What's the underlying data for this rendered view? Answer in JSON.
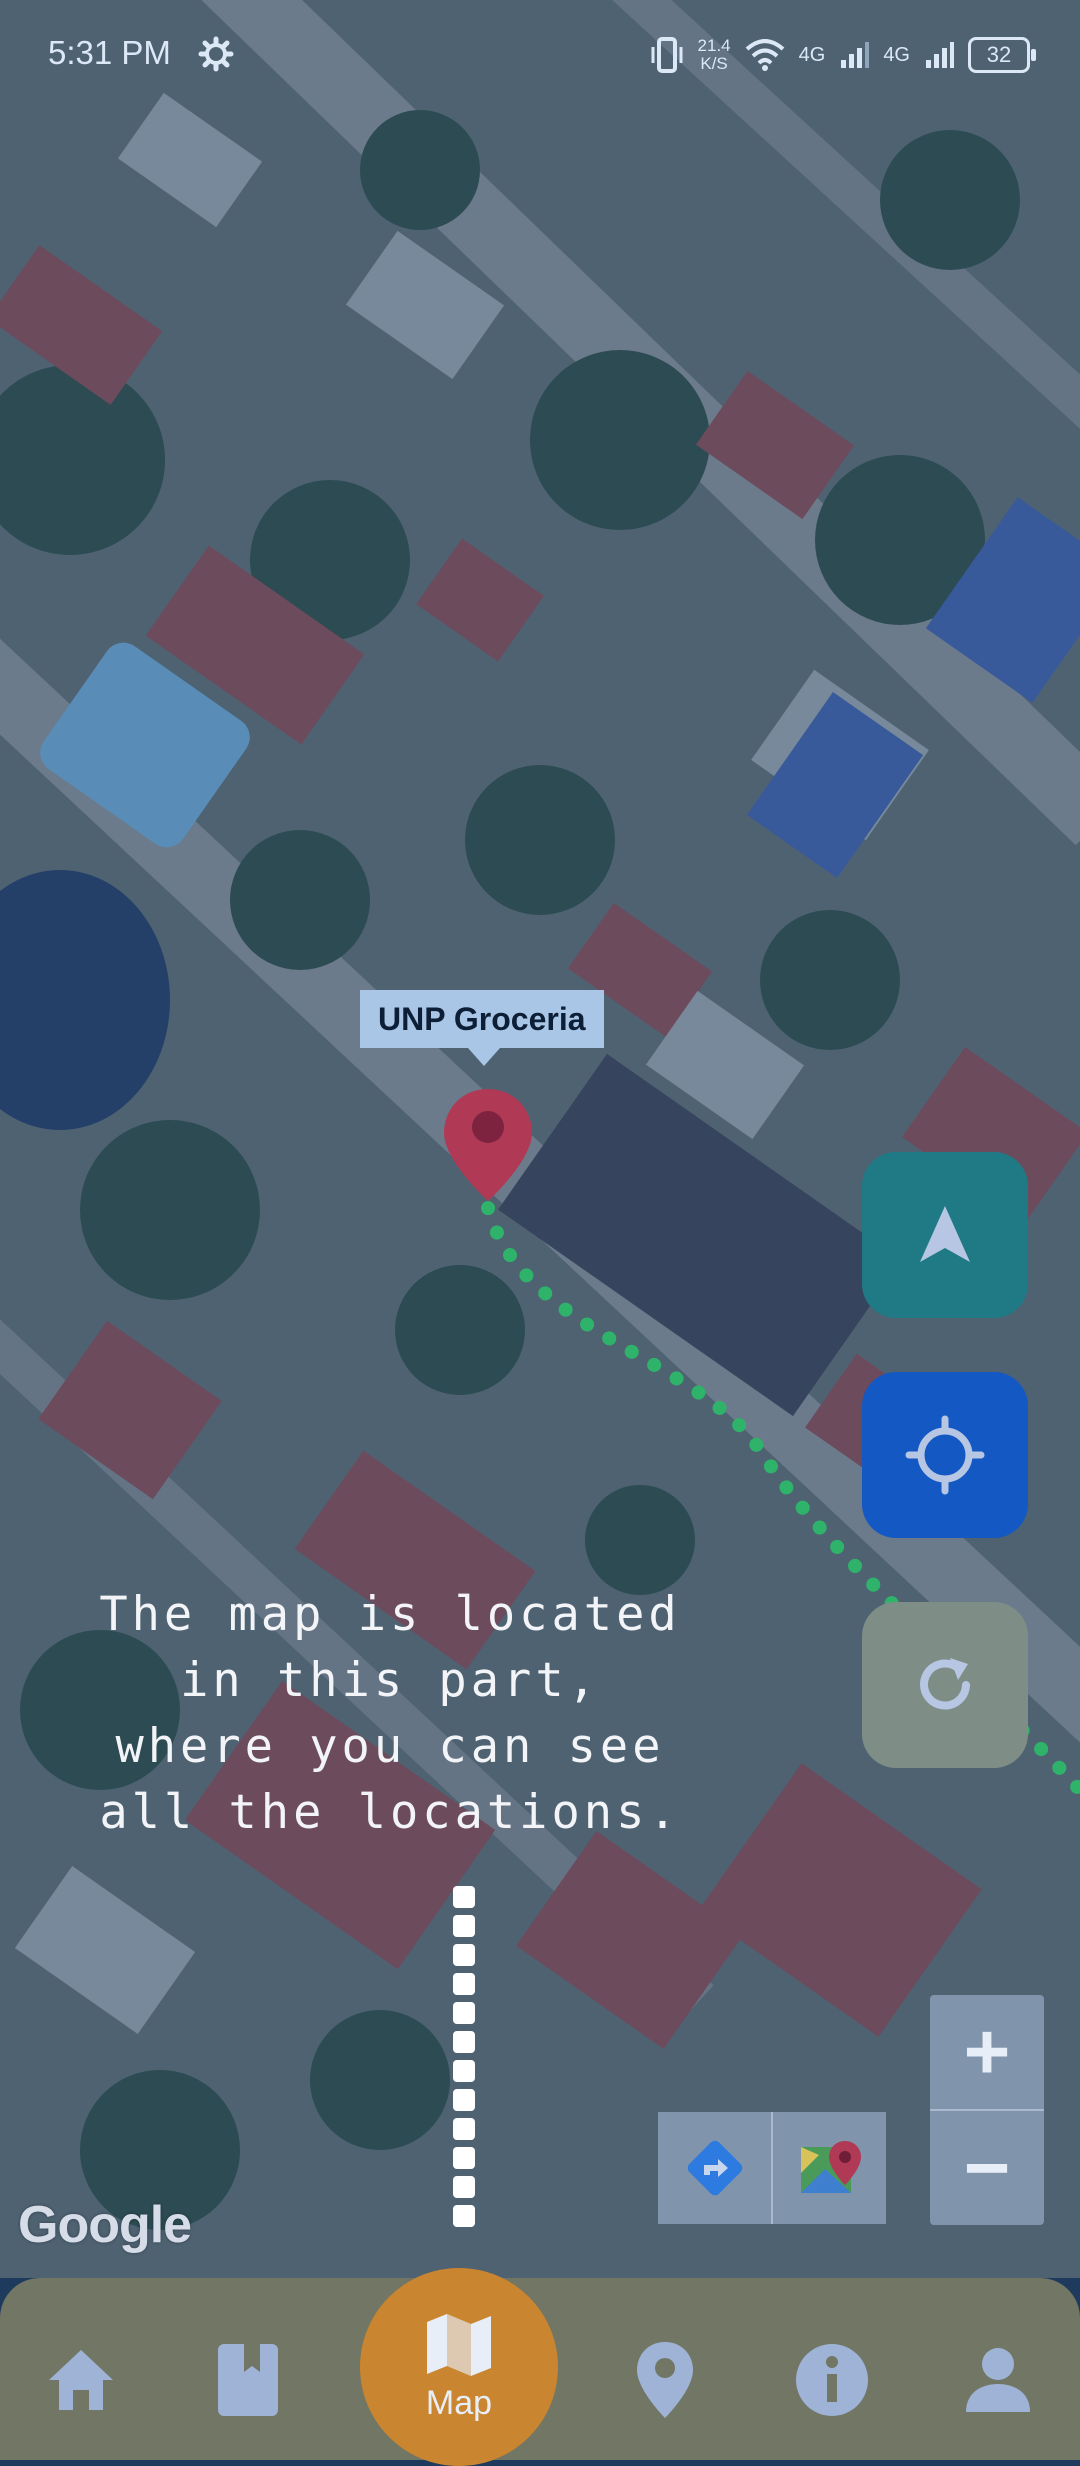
{
  "status_bar": {
    "time": "5:31 PM",
    "network_speed_value": "21.4",
    "network_speed_unit": "K/S",
    "network_1": "4G",
    "network_2": "4G",
    "battery": "32"
  },
  "map": {
    "marker_label": "UNP Groceria",
    "attribution": "Google",
    "route_color": "#2fb36a",
    "marker_color": "#b03a55"
  },
  "tutorial": {
    "text": "The map is located in this part, where you can see all the locations."
  },
  "controls": {
    "zoom_in": "+",
    "zoom_out": "−",
    "navigate_color": "#1f7a86",
    "locate_color": "#1458c4",
    "refresh_color": "#7e8e86"
  },
  "bottom_nav": {
    "items": [
      {
        "icon": "home-icon"
      },
      {
        "icon": "bookmark-icon"
      },
      {
        "icon": "map-icon",
        "label": "Map",
        "active": true
      },
      {
        "icon": "location-pin-icon"
      },
      {
        "icon": "info-icon"
      },
      {
        "icon": "profile-icon"
      }
    ],
    "active_color": "#c9852f",
    "bar_color": "#717665"
  }
}
